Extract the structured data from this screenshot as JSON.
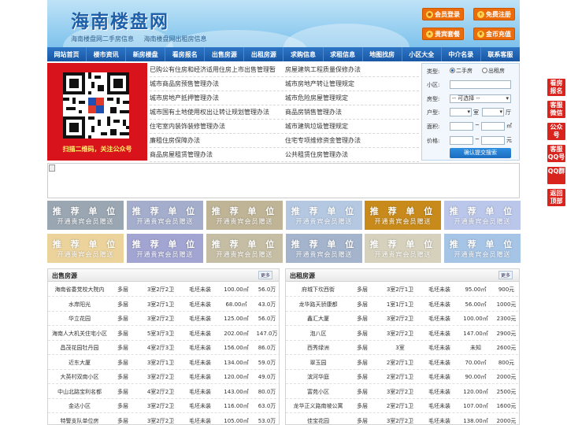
{
  "header": {
    "title": "海南楼盘网",
    "sub_links": [
      "海南楼盘网二手房信息",
      "海南楼盘网出租房信息"
    ],
    "buttons": [
      {
        "label": "会员登录",
        "icon": "user-icon"
      },
      {
        "label": "免费注册",
        "icon": "register-icon"
      },
      {
        "label": "贵宾套餐",
        "icon": "vip-icon"
      },
      {
        "label": "金币充值",
        "icon": "coin-icon"
      }
    ]
  },
  "nav": [
    "网站首页",
    "楼市资讯",
    "新房楼盘",
    "看房报名",
    "出售房源",
    "出租房源",
    "求购信息",
    "求租信息",
    "地图找房",
    "小区大全",
    "中介名录",
    "联系客服"
  ],
  "banner": {
    "caption": "扫描二维码，关注公众号"
  },
  "articles_left": [
    "已购公有住房和经济适用住房上市出售管理暂",
    "城市商品房预售管理办法",
    "城市房地产抵押管理办法",
    "城市国有土地使用权出让转让规划管理办法",
    "住宅室内装饰装修管理办法",
    "廉租住房保障办法",
    "商品房屋租赁管理办法"
  ],
  "articles_right": [
    "房屋建筑工程质量保修办法",
    "城市房地产转让管理规定",
    "城市危险房屋管理规定",
    "商品房销售管理办法",
    "城市建筑垃圾管理规定",
    "住宅专项维修资金管理办法",
    "公共租赁住房管理办法"
  ],
  "search": {
    "type_label": "类型:",
    "type_options": [
      "二手房",
      "出租房"
    ],
    "type_selected": "二手房",
    "community_label": "小区:",
    "community_value": "",
    "rooms_label": "房型:",
    "rooms_value": "-- 可选择 --",
    "layout_label": "户型:",
    "layout_units": [
      "室",
      "厅"
    ],
    "area_label": "面积:",
    "area_sep": "~",
    "area_unit": "㎡",
    "price_label": "价格:",
    "price_sep": "~",
    "price_unit": "元",
    "submit": "确认提交搜索"
  },
  "ads": {
    "title": "推 荐 单 位",
    "subtitle": "开通贵宾会员赠送",
    "colors": [
      "#9aa6b2",
      "#a4aecc",
      "#bfb496",
      "#b4c8e2",
      "#c88a1a",
      "#bac6ea",
      "#ecd39c",
      "#a2a4d2",
      "#c6bea4",
      "#a4b4cc",
      "#d6d1bc",
      "#a6c4e6"
    ]
  },
  "sale": {
    "title": "出售房源",
    "more": "更多",
    "rows": [
      [
        "海南省委党校大院内",
        "多层",
        "3室2厅2卫",
        "毛坯未装",
        "100.00㎡",
        "56.0万"
      ],
      [
        "水岸阳光",
        "多层",
        "3室2厅1卫",
        "毛坯未装",
        "68.00㎡",
        "43.0万"
      ],
      [
        "华立花园",
        "多层",
        "3室2厅2卫",
        "毛坯未装",
        "125.00㎡",
        "56.0万"
      ],
      [
        "海南人大机关住宅小区",
        "多层",
        "5室3厅3卫",
        "毛坯未装",
        "202.00㎡",
        "147.0万"
      ],
      [
        "昌茂花园牡丹园",
        "多层",
        "4室2厅3卫",
        "毛坯未装",
        "156.00㎡",
        "86.0万"
      ],
      [
        "近东大厦",
        "多层",
        "3室2厅1卫",
        "毛坯未装",
        "134.00㎡",
        "59.0万"
      ],
      [
        "大英村双南小区",
        "多层",
        "3室2厅2卫",
        "毛坯未装",
        "120.00㎡",
        "49.0万"
      ],
      [
        "中山北路宝利名都",
        "多层",
        "4室2厅2卫",
        "毛坯未装",
        "143.00㎡",
        "80.0万"
      ],
      [
        "金达小区",
        "多层",
        "3室2厅2卫",
        "毛坯未装",
        "116.00㎡",
        "63.0万"
      ],
      [
        "特警支队单位房",
        "多层",
        "3室2厅2卫",
        "毛坯未装",
        "105.00㎡",
        "53.0万"
      ]
    ]
  },
  "rent": {
    "title": "出租房源",
    "more": "更多",
    "rows": [
      [
        "府城下坎西街",
        "多层",
        "3室2厅1卫",
        "毛坯未装",
        "95.00㎡",
        "900元"
      ],
      [
        "龙华路天骄康都",
        "多层",
        "1室1厅1卫",
        "毛坯未装",
        "56.00㎡",
        "1000元"
      ],
      [
        "鑫汇大厦",
        "多层",
        "3室2厅2卫",
        "毛坯未装",
        "100.00㎡",
        "2300元"
      ],
      [
        "泡八区",
        "多层",
        "3室2厅2卫",
        "毛坯未装",
        "147.00㎡",
        "2900元"
      ],
      [
        "西秀绿洲",
        "多层",
        "3室",
        "毛坯未装",
        "未知",
        "2600元"
      ],
      [
        "翠玉园",
        "多层",
        "2室2厅1卫",
        "毛坯未装",
        "70.00㎡",
        "800元"
      ],
      [
        "滨河华庭",
        "多层",
        "2室2厅1卫",
        "毛坯未装",
        "90.00㎡",
        "2000元"
      ],
      [
        "富苑小区",
        "多层",
        "3室2厅2卫",
        "毛坯未装",
        "120.00㎡",
        "2500元"
      ],
      [
        "龙华正义路南坡公寓",
        "多层",
        "2室2厅1卫",
        "毛坯未装",
        "107.00㎡",
        "1600元"
      ],
      [
        "佳宝花园",
        "多层",
        "3室2厅2卫",
        "毛坯未装",
        "138.00㎡",
        "2000元"
      ]
    ]
  },
  "sidebar": [
    "看房报名",
    "客服微信",
    "公众号",
    "客服QQ号",
    "QQ群",
    "返回顶部"
  ],
  "colors": {
    "nav_blue": "#1f66b5",
    "orange": "#ec6c0c",
    "banner_red": "#d8131b",
    "side_red": "#d9231d"
  }
}
